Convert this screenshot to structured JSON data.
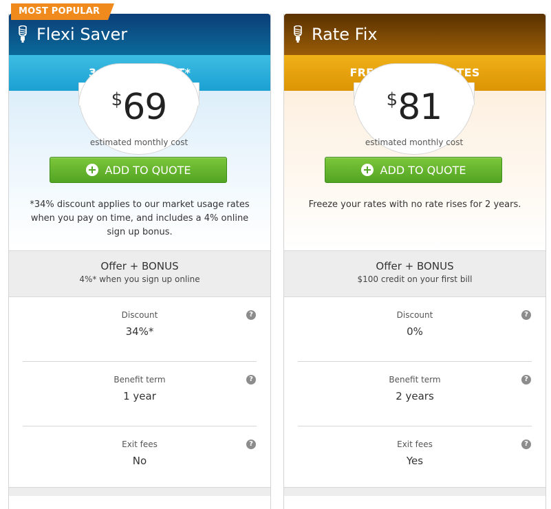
{
  "ribbon": {
    "label": "MOST POPULAR"
  },
  "plans": [
    {
      "name": "Flexi Saver",
      "band": "34% DISCOUNT*",
      "currency": "$",
      "price": "69",
      "price_caption": "estimated monthly cost",
      "button_label": "ADD TO QUOTE",
      "note": "*34% discount applies to our market usage rates when you pay on time, and includes a 4% online sign up bonus.",
      "offer_title": "Offer + BONUS",
      "offer_sub": "4%* when you sign up online",
      "features": [
        {
          "label": "Discount",
          "value": "34%*"
        },
        {
          "label": "Benefit term",
          "value": "1 year"
        },
        {
          "label": "Exit fees",
          "value": "No"
        }
      ]
    },
    {
      "name": "Rate Fix",
      "band": "FREEZE YOUR RATES",
      "currency": "$",
      "price": "81",
      "price_caption": "estimated monthly cost",
      "button_label": "ADD TO QUOTE",
      "note": "Freeze your rates with no rate rises for 2 years.",
      "offer_title": "Offer + BONUS",
      "offer_sub": "$100 credit on your first bill",
      "features": [
        {
          "label": "Discount",
          "value": "0%"
        },
        {
          "label": "Benefit term",
          "value": "2 years"
        },
        {
          "label": "Exit fees",
          "value": "Yes"
        }
      ]
    }
  ],
  "help_glyph": "?",
  "colors": {
    "flexi_header": "#0c3e78",
    "flexi_band": "#1ba0d2",
    "ratefix_header": "#7a4604",
    "ratefix_band": "#e8a20c",
    "button_green": "#5fae29",
    "ribbon_orange": "#f08a1c"
  }
}
